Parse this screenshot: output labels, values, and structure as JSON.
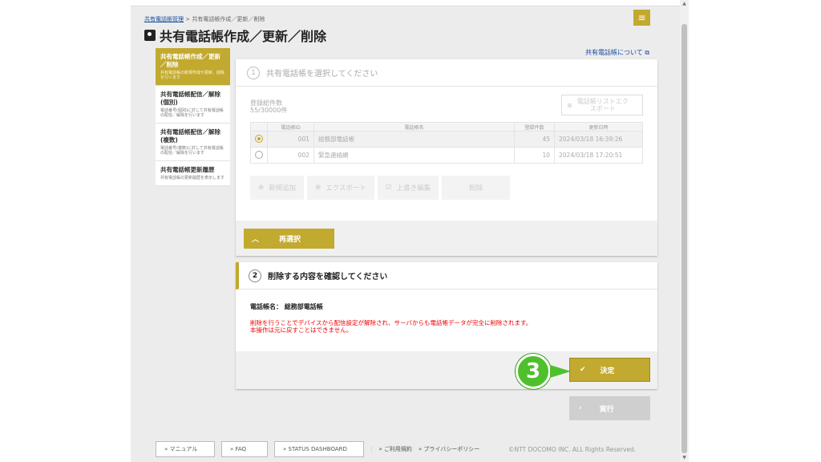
{
  "breadcrumb": {
    "root": "共有電話帳管理",
    "separator": " > ",
    "current": "共有電話帳作成／更新／削除"
  },
  "page_title": "共有電話帳作成／更新／削除",
  "about_link": "共有電話帳について",
  "sidebar": {
    "items": [
      {
        "title": "共有電話帳作成／更新／削除",
        "desc": "共有電話帳の新規作成や更新、削除を行います",
        "active": true
      },
      {
        "title": "共有電話帳配信／解除(個別)",
        "desc": "電話番号(個別)に対して共有電話帳の配信／解除を行います",
        "active": false
      },
      {
        "title": "共有電話帳配信／解除(複数)",
        "desc": "電話番号(複数)に対して共有電話帳の配信／解除を行います",
        "active": false
      },
      {
        "title": "共有電話帳更新履歴",
        "desc": "共有電話帳の更新履歴を表示します",
        "active": false
      }
    ]
  },
  "step1": {
    "number": "1",
    "title": "共有電話帳を選択してください",
    "reg_count_label": "登録総件数",
    "reg_count_value": "55/30000件",
    "export_list": "電話帳リストエクスポート",
    "columns": [
      "電話帳ID",
      "電話帳名",
      "登録件数",
      "更新日時"
    ],
    "rows": [
      {
        "id": "001",
        "name": "総務部電話帳",
        "count": "45",
        "updated": "2024/03/18 16:39:26",
        "selected": true
      },
      {
        "id": "002",
        "name": "緊急連絡網",
        "count": "10",
        "updated": "2024/03/18 17:20:51",
        "selected": false
      }
    ],
    "actions": [
      "新規追加",
      "エクスポート",
      "上書き編集",
      "削除"
    ],
    "reselect": "再選択"
  },
  "step2": {
    "number": "2",
    "title": "削除する内容を確認してください",
    "name_label": "電話帳名：",
    "name_value": "総務部電話帳",
    "warning_1": "削除を行うことでデバイスから配信設定が解除され、サーバからも電話帳データが完全に削除されます。",
    "warning_2": "本操作は元に戻すことはできません。",
    "decide": "決定"
  },
  "callout_number": "3",
  "execute": "実行",
  "footer": {
    "manual": "» マニュアル",
    "faq": "» FAQ",
    "status": "» STATUS DASHBOARD",
    "terms": "» ご利用規約",
    "privacy": "» プライバシーポリシー",
    "copyright": "©NTT DOCOMO INC. ALL Rights Reserved."
  },
  "colors": {
    "accent": "#c2a92f",
    "warning": "#e00000",
    "callout": "#4fbf2c"
  }
}
